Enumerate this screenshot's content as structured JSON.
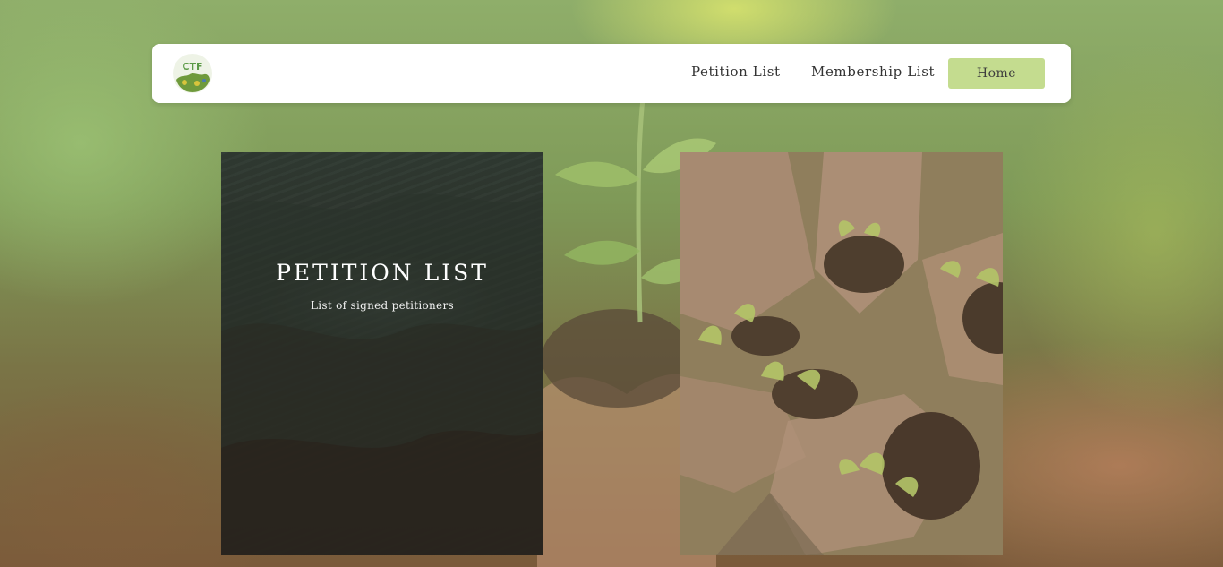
{
  "navbar": {
    "logo_text": "CTF",
    "links": [
      {
        "label": "Petition List"
      },
      {
        "label": "Membership List"
      }
    ],
    "home_label": "Home"
  },
  "cards": {
    "petition": {
      "title": "PETITION LIST",
      "subtitle": "List of signed petitioners"
    }
  },
  "colors": {
    "accent": "#c4dc8f",
    "navbar_bg": "#ffffff",
    "petition_card_bg": "#2d2c25"
  }
}
